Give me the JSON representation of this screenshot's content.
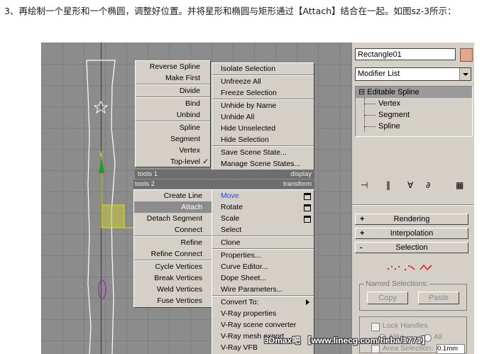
{
  "caption": "3、再绘制一个星形和一个椭圆，调整好位置。并将星形和椭圆与矩形通过【Attach】结合在一起。如图sz-3所示：",
  "viewport": {
    "axis_label": "y"
  },
  "quad_menu": {
    "left_top": [
      {
        "label": "Reverse Spline"
      },
      {
        "label": "Make First"
      },
      {
        "label": "Divide"
      },
      {
        "label": "Bind"
      },
      {
        "label": "Unbind"
      },
      {
        "label": "Spline"
      },
      {
        "label": "Segment"
      },
      {
        "label": "Vertex"
      },
      {
        "label": "Top-level",
        "checked": "✓"
      }
    ],
    "right_top": [
      {
        "label": "Isolate Selection"
      },
      {
        "label": "Unfreeze All"
      },
      {
        "label": "Freeze Selection"
      },
      {
        "label": "Unhide by Name"
      },
      {
        "label": "Unhide All"
      },
      {
        "label": "Hide Unselected"
      },
      {
        "label": "Hide Selection"
      },
      {
        "label": "Save Scene State..."
      },
      {
        "label": "Manage Scene States..."
      }
    ],
    "title_tools1": "tools 1",
    "title_display": "display",
    "title_tools2": "tools 2",
    "title_transform": "transform",
    "left_bottom": [
      {
        "label": "Create Line"
      },
      {
        "label": "Attach"
      },
      {
        "label": "Detach Segment"
      },
      {
        "label": "Connect"
      },
      {
        "label": "Refine"
      },
      {
        "label": "Refine Connect"
      },
      {
        "label": "Cycle Vertices"
      },
      {
        "label": "Break Vertices"
      },
      {
        "label": "Weld Vertices"
      },
      {
        "label": "Fuse Vertices"
      }
    ],
    "right_bottom": [
      {
        "label": "Move"
      },
      {
        "label": "Rotate"
      },
      {
        "label": "Scale"
      },
      {
        "label": "Select"
      },
      {
        "label": "Clone"
      },
      {
        "label": "Properties..."
      },
      {
        "label": "Curve Editor..."
      },
      {
        "label": "Dope Sheet..."
      },
      {
        "label": "Wire Parameters..."
      },
      {
        "label": "Convert To:"
      },
      {
        "label": "V-Ray properties"
      },
      {
        "label": "V-Ray scene converter"
      },
      {
        "label": "V-Ray mesh export"
      },
      {
        "label": "V-Ray VFB"
      }
    ]
  },
  "command_panel": {
    "object_name": "Rectangle01",
    "object_color": "#e0a888",
    "modifier_list": "Modifier List",
    "stack": {
      "top": "Editable Spline",
      "expander": "⊟",
      "children": [
        "Vertex",
        "Segment",
        "Spline"
      ]
    },
    "rollouts": [
      {
        "sign": "+",
        "label": "Rendering"
      },
      {
        "sign": "+",
        "label": "Interpolation"
      },
      {
        "sign": "-",
        "label": "Selection"
      }
    ],
    "named_selections": {
      "label": "Named Selections:",
      "copy": "Copy",
      "paste": "Paste"
    },
    "lock_handles": "Lock Handles",
    "alike": "Alike",
    "all": "All",
    "area_selection": "Area Selection:",
    "area_value": "0.1mm"
  },
  "watermark": "3Dmax吧 【www.linecg.com/tieba/1771】"
}
